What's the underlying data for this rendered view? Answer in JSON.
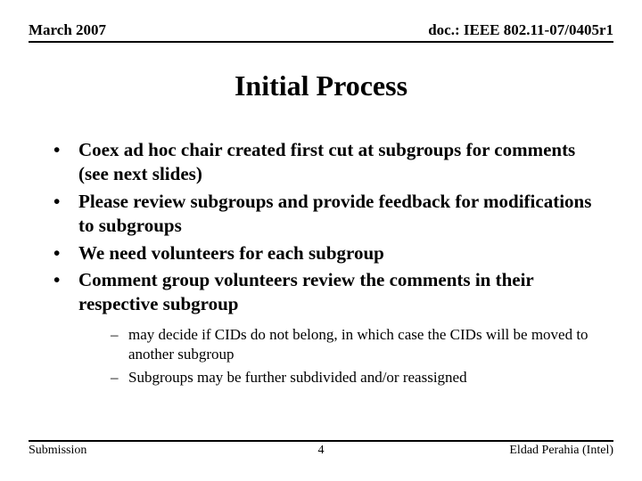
{
  "header": {
    "left": "March 2007",
    "right": "doc.: IEEE 802.11-07/0405r1"
  },
  "title": "Initial Process",
  "bullets": [
    {
      "text": "Coex ad hoc chair created first cut at subgroups for comments (see next slides)"
    },
    {
      "text": "Please review subgroups and provide feedback for modifications to subgroups"
    },
    {
      "text": "We need volunteers for each subgroup"
    },
    {
      "text": "Comment group volunteers review the comments in their respective subgroup",
      "sub": [
        "may decide if CIDs do not belong, in which case the CIDs will be moved to another subgroup",
        "Subgroups may be further subdivided and/or reassigned"
      ]
    }
  ],
  "footer": {
    "left": "Submission",
    "center": "4",
    "right": "Eldad Perahia (Intel)"
  }
}
